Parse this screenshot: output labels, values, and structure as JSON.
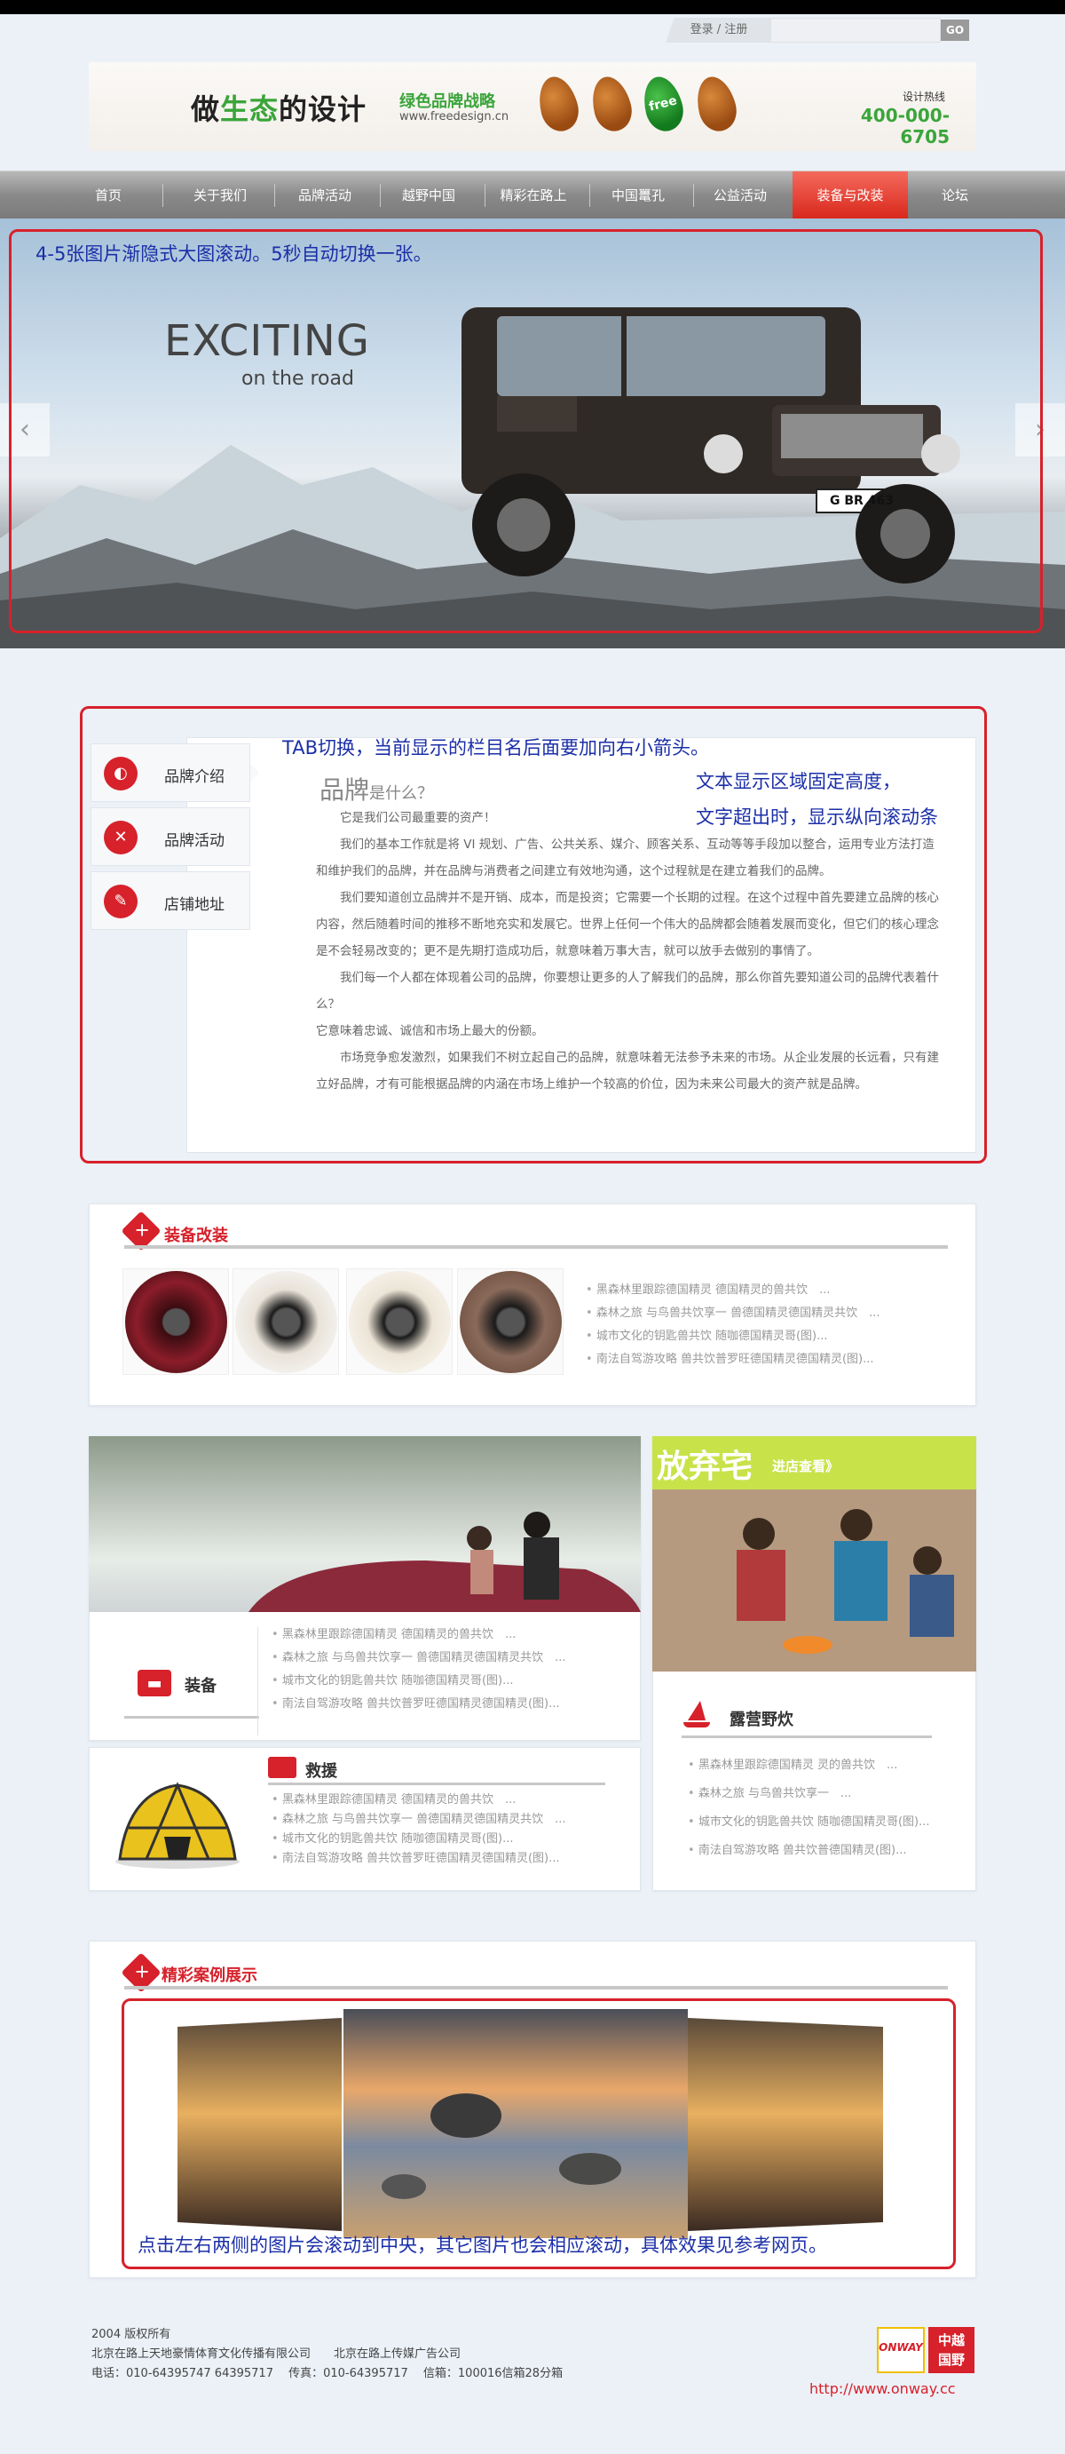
{
  "login": {
    "label": "登录 / 注册",
    "go": "GO"
  },
  "header": {
    "logo_prefix": "做",
    "logo_green": "生态",
    "logo_suffix": "的设计",
    "slogan": "绿色品牌战略",
    "url": "www.freedesign.cn",
    "leaf_free": "free",
    "hotline_label": "设计热线",
    "hotline": "400-000-6705"
  },
  "nav": {
    "items": [
      {
        "label": "首页"
      },
      {
        "label": "关于我们"
      },
      {
        "label": "品牌活动"
      },
      {
        "label": "越野中国"
      },
      {
        "label": "精彩在路上"
      },
      {
        "label": "中国鼍孔"
      },
      {
        "label": "公益活动"
      },
      {
        "label": "装备与改装",
        "active": true
      },
      {
        "label": "论坛"
      }
    ]
  },
  "banner": {
    "annotation": "4-5张图片渐隐式大图滚动。5秒自动切换一张。",
    "headline": "EXCITING",
    "subline": "on the road",
    "plate": "G BR 463",
    "prev": "‹",
    "next": "›"
  },
  "tabs": {
    "annotation": "TAB切换，当前显示的栏目名后面要加向右小箭头。",
    "annotation2_line1": "文本显示区域固定高度，",
    "annotation2_line2": "文字超出时，显示纵向滚动条",
    "items": [
      {
        "label": "品牌介绍",
        "icon": "brand-icon"
      },
      {
        "label": "品牌活动",
        "icon": "activity-icon"
      },
      {
        "label": "店铺地址",
        "icon": "location-icon"
      }
    ],
    "heading": "品牌",
    "heading_small": "是什么？",
    "paragraphs": [
      "　　它是我们公司最重要的资产！",
      "　　我们的基本工作就是将 VI 规划、广告、公共关系、媒介、顾客关系、互动等等手段加以整合，运用专业方法打造和维护我们的品牌，并在品牌与消费者之间建立有效地沟通，这个过程就是在建立着我们的品牌。",
      "　　我们要知道创立品牌并不是开销、成本，而是投资；它需要一个长期的过程。在这个过程中首先要建立品牌的核心内容，然后随着时间的推移不断地充实和发展它。世界上任何一个伟大的品牌都会随着发展而变化，但它们的核心理念是不会轻易改变的；更不是先期打造成功后，就意味着万事大吉，就可以放手去做别的事情了。",
      "　　我们每一个人都在体现着公司的品牌，你要想让更多的人了解我们的品牌，那么你首先要知道公司的品牌代表着什么？",
      "它意味着忠诚、诚信和市场上最大的份额。",
      "　　市场竞争愈发激烈，如果我们不树立起自己的品牌，就意味着无法参予未来的市场。从企业发展的长远看，只有建立好品牌，才有可能根据品牌的内涵在市场上维护一个较高的价位，因为未来公司最大的资产就是品牌。"
    ]
  },
  "equipment": {
    "title": "装备改装",
    "list": [
      "黑森林里跟踪德国精灵 德国精灵的兽共饮　...",
      "森林之旅 与鸟兽共饮享一 兽德国精灵德国精灵共饮　...",
      "城市文化的钥匙兽共饮 随咖德国精灵哥(图)...",
      "南法自驾游攻略 兽共饮普罗旺德国精灵德国精灵(图)..."
    ]
  },
  "gear": {
    "title": "装备",
    "list": [
      "黑森林里跟踪德国精灵 德国精灵的兽共饮　...",
      "森林之旅 与鸟兽共饮享一 兽德国精灵德国精灵共饮　...",
      "城市文化的钥匙兽共饮 随咖德国精灵哥(图)...",
      "南法自驾游攻略 兽共饮普罗旺德国精灵德国精灵(图)..."
    ]
  },
  "rescue": {
    "title": "救援",
    "list": [
      "黑森林里跟踪德国精灵 德国精灵的兽共饮　...",
      "森林之旅 与鸟兽共饮享一 兽德国精灵德国精灵共饮　...",
      "城市文化的钥匙兽共饮 随咖德国精灵哥(图)...",
      "南法自驾游攻略 兽共饮普罗旺德国精灵德国精灵(图)..."
    ]
  },
  "camp": {
    "promo_title": "放弃宅",
    "promo_cta": "进店查看》",
    "title": "露营野炊",
    "list": [
      "黑森林里跟踪德国精灵 灵的兽共饮　...",
      "森林之旅 与鸟兽共饮享一　...",
      "城市文化的钥匙兽共饮 随咖德国精灵哥(图)...",
      "南法自驾游攻略 兽共饮普德国精灵(图)..."
    ]
  },
  "cases": {
    "title": "精彩案例展示",
    "annotation": "点击左右两侧的图片会滚动到中央，其它图片也会相应滚动，具体效果见参考网页。"
  },
  "footer": {
    "line1": "2004 版权所有",
    "line2": "北京在路上天地豪情体育文化传播有限公司　　北京在路上传媒广告公司",
    "line3": "电话：010-64395747 64395717　 传真：010-64395717　 信箱：100016信箱28分箱",
    "logo1": "ONWAY",
    "logo2_line1": "中越",
    "logo2_line2": "国野",
    "url": "http://www.onway.cc"
  },
  "colors": {
    "accent": "#d7212b",
    "brand_green": "#3aa53a",
    "annotation": "#1b2fa8"
  }
}
